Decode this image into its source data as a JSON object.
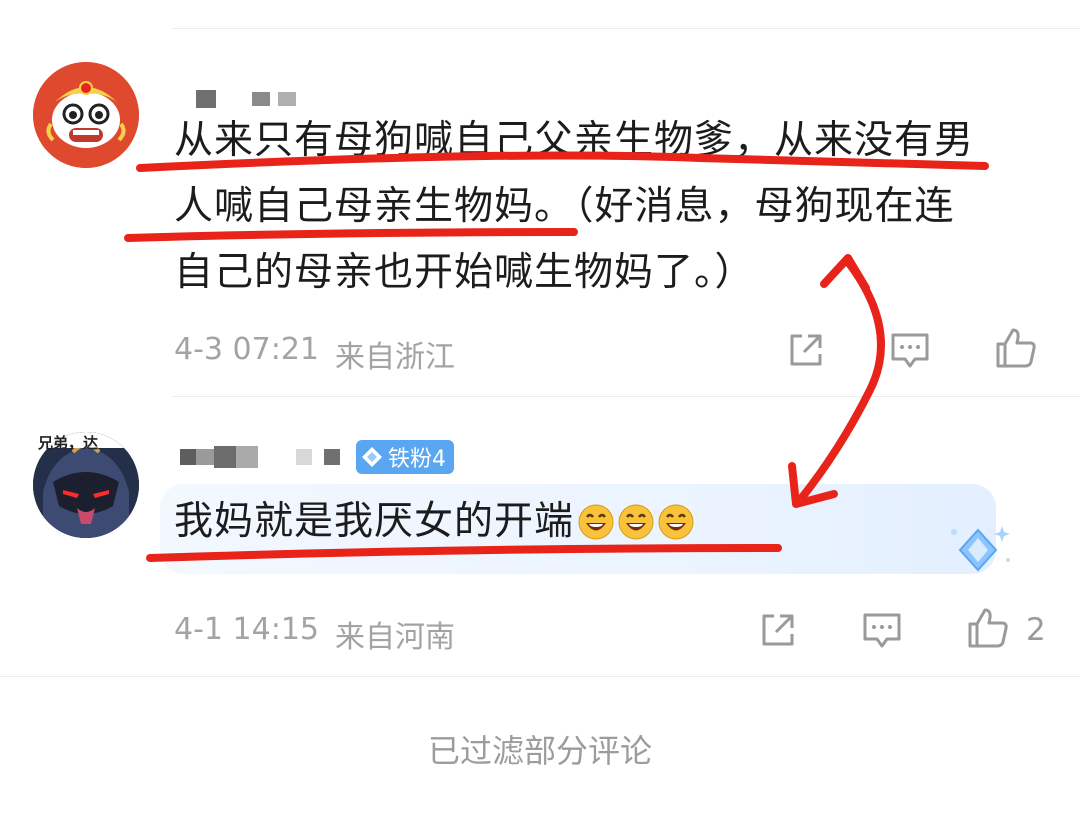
{
  "comments": [
    {
      "text_line1": "从来只有母狗喊自己父亲生物爹，从来没有男",
      "text_line2": "人喊自己母亲生物妈。（好消息，母狗现在连",
      "text_line3": "自己的母亲也开始喊生物妈了。）",
      "date": "4-3 07:21",
      "location": "来自浙江",
      "avatar_icon": "lion-dance-icon",
      "likes": ""
    },
    {
      "text": "我妈就是我厌女的开端",
      "date": "4-1 14:15",
      "location": "来自河南",
      "avatar_caption": "兄弟，达",
      "badge_label": "铁粉4",
      "avatar_icon": "masked-warrior-icon",
      "likes": "2"
    }
  ],
  "footer": {
    "filtered_notice": "已过滤部分评论"
  },
  "colors": {
    "annotation_red": "#e8231a",
    "badge_blue": "#5aa6f0",
    "meta_gray": "#a3a3a3"
  }
}
